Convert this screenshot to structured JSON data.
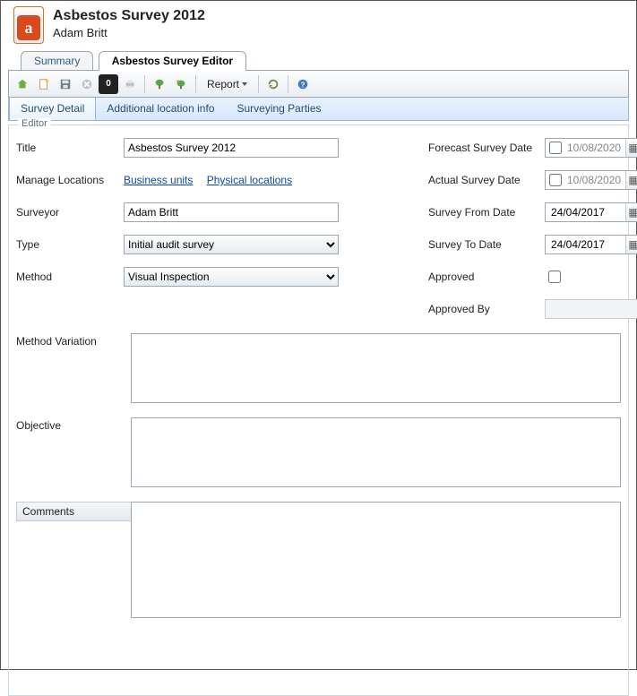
{
  "header": {
    "title": "Asbestos Survey 2012",
    "subtitle": "Adam Britt"
  },
  "tabs": {
    "summary": "Summary",
    "editor": "Asbestos Survey Editor"
  },
  "toolbar": {
    "report_label": "Report"
  },
  "subtabs": {
    "detail": "Survey Detail",
    "addloc": "Additional location info",
    "parties": "Surveying Parties"
  },
  "legend": "Editor",
  "labels": {
    "title": "Title",
    "manage_locations": "Manage Locations",
    "surveyor": "Surveyor",
    "type": "Type",
    "method": "Method",
    "forecast_date": "Forecast Survey Date",
    "actual_date": "Actual Survey Date",
    "from_date": "Survey From Date",
    "to_date": "Survey To Date",
    "approved": "Approved",
    "approved_by": "Approved By",
    "method_variation": "Method Variation",
    "objective": "Objective",
    "comments": "Comments"
  },
  "links": {
    "business_units": "Business units",
    "physical_locations": "Physical locations"
  },
  "values": {
    "title": "Asbestos Survey 2012",
    "surveyor": "Adam Britt",
    "type": "Initial audit survey",
    "method": "Visual Inspection",
    "forecast_date": "10/08/2020",
    "forecast_date_enabled": false,
    "actual_date": "10/08/2020",
    "actual_date_enabled": false,
    "from_date": "24/04/2017",
    "to_date": "24/04/2017",
    "approved": false,
    "approved_by": "",
    "method_variation": "",
    "objective": "",
    "comments": ""
  }
}
